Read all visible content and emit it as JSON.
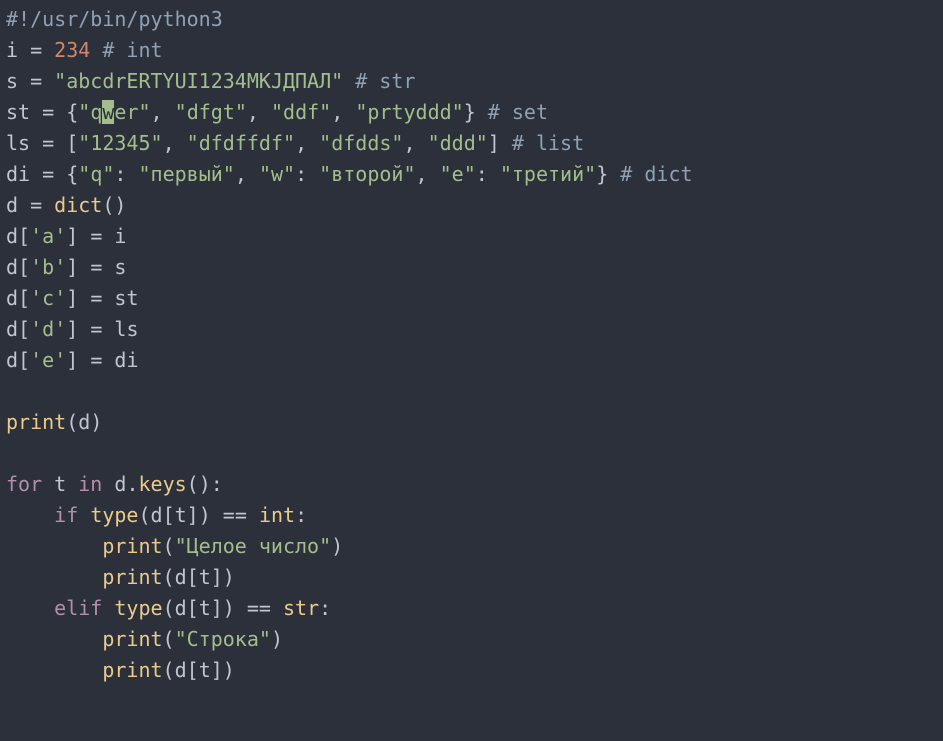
{
  "line1": {
    "shebang": "#!/usr/bin/python3"
  },
  "line2": {
    "var": "i",
    "eq": " = ",
    "val": "234",
    "comment": " # int"
  },
  "line3": {
    "var": "s",
    "eq": " = ",
    "q1": "\"",
    "str": "abcdrERTYUI1234MKJДПАЛ",
    "q2": "\"",
    "comment": " # str"
  },
  "line4": {
    "var": "st",
    "eq": " = ",
    "lb": "{",
    "q1a": "\"",
    "s1a": "q",
    "cursor": "w",
    "s1b": "er",
    "q1b": "\"",
    "c1": ", ",
    "q2a": "\"",
    "s2": "dfgt",
    "q2b": "\"",
    "c2": ", ",
    "q3a": "\"",
    "s3": "ddf",
    "q3b": "\"",
    "c3": ", ",
    "q4a": "\"",
    "s4": "prtyddd",
    "q4b": "\"",
    "rb": "}",
    "comment": " # set"
  },
  "line5": {
    "var": "ls",
    "eq": " = ",
    "lb": "[",
    "q1a": "\"",
    "s1": "12345",
    "q1b": "\"",
    "c1": ", ",
    "q2a": "\"",
    "s2": "dfdffdf",
    "q2b": "\"",
    "c2": ", ",
    "q3a": "\"",
    "s3": "dfdds",
    "q3b": "\"",
    "c3": ", ",
    "q4a": "\"",
    "s4": "ddd",
    "q4b": "\"",
    "rb": "]",
    "comment": " # list"
  },
  "line6": {
    "var": "di",
    "eq": " = ",
    "lb": "{",
    "k1a": "\"",
    "k1": "q",
    "k1b": "\"",
    "col1": ": ",
    "v1a": "\"",
    "v1": "первый",
    "v1b": "\"",
    "c1": ", ",
    "k2a": "\"",
    "k2": "w",
    "k2b": "\"",
    "col2": ": ",
    "v2a": "\"",
    "v2": "второй",
    "v2b": "\"",
    "c2": ", ",
    "k3a": "\"",
    "k3": "e",
    "k3b": "\"",
    "col3": ": ",
    "v3a": "\"",
    "v3": "третий",
    "v3b": "\"",
    "rb": "}",
    "comment": " # dict"
  },
  "line7": {
    "var": "d",
    "eq": " = ",
    "func": "dict",
    "lp": "(",
    "rp": ")"
  },
  "line8": {
    "var": "d",
    "lb": "[",
    "q1": "'",
    "k": "a",
    "q2": "'",
    "rb": "]",
    "eq": " = ",
    "rhs": "i"
  },
  "line9": {
    "var": "d",
    "lb": "[",
    "q1": "'",
    "k": "b",
    "q2": "'",
    "rb": "]",
    "eq": " = ",
    "rhs": "s"
  },
  "line10": {
    "var": "d",
    "lb": "[",
    "q1": "'",
    "k": "c",
    "q2": "'",
    "rb": "]",
    "eq": " = ",
    "rhs": "st"
  },
  "line11": {
    "var": "d",
    "lb": "[",
    "q1": "'",
    "k": "d",
    "q2": "'",
    "rb": "]",
    "eq": " = ",
    "rhs": "ls"
  },
  "line12": {
    "var": "d",
    "lb": "[",
    "q1": "'",
    "k": "e",
    "q2": "'",
    "rb": "]",
    "eq": " = ",
    "rhs": "di"
  },
  "line14": {
    "func": "print",
    "lp": "(",
    "arg": "d",
    "rp": ")"
  },
  "line16": {
    "kw_for": "for",
    "sp1": " ",
    "t": "t",
    "sp2": " ",
    "kw_in": "in",
    "sp3": " ",
    "d": "d",
    "dot": ".",
    "keys": "keys",
    "lp": "(",
    "rp": ")",
    "colon": ":"
  },
  "line17": {
    "indent": "    ",
    "kw_if": "if",
    "sp": " ",
    "type": "type",
    "lp": "(",
    "d": "d",
    "lb": "[",
    "t": "t",
    "rb": "]",
    "rp": ")",
    "eqeq": " == ",
    "int": "int",
    "colon": ":"
  },
  "line18": {
    "indent": "        ",
    "print": "print",
    "lp": "(",
    "q1": "\"",
    "s": "Целое число",
    "q2": "\"",
    "rp": ")"
  },
  "line19": {
    "indent": "        ",
    "print": "print",
    "lp": "(",
    "d": "d",
    "lb": "[",
    "t": "t",
    "rb": "]",
    "rp": ")"
  },
  "line20": {
    "indent": "    ",
    "kw_elif": "elif",
    "sp": " ",
    "type": "type",
    "lp": "(",
    "d": "d",
    "lb": "[",
    "t": "t",
    "rb": "]",
    "rp": ")",
    "eqeq": " == ",
    "str": "str",
    "colon": ":"
  },
  "line21": {
    "indent": "        ",
    "print": "print",
    "lp": "(",
    "q1": "\"",
    "s": "Строка",
    "q2": "\"",
    "rp": ")"
  },
  "line22": {
    "indent": "        ",
    "print": "print",
    "lp": "(",
    "d": "d",
    "lb": "[",
    "t": "t",
    "rb": "]",
    "rp": ")"
  }
}
